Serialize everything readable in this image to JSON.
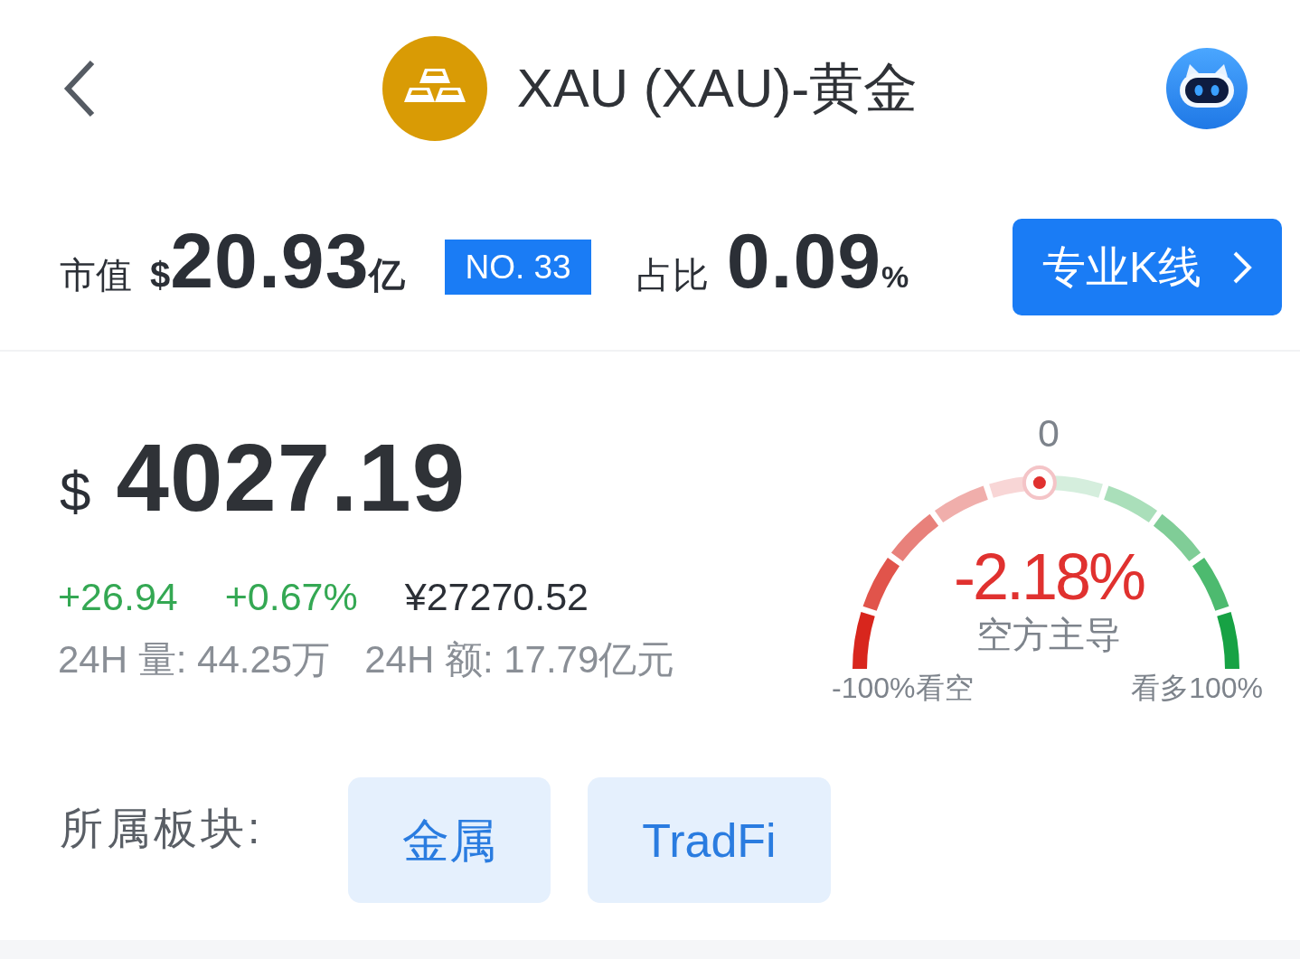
{
  "header": {
    "title": "XAU (XAU)-黄金"
  },
  "market": {
    "cap_label": "市值",
    "cap_currency": "$",
    "cap_value": "20.93",
    "cap_unit": "亿",
    "rank": "NO. 33",
    "share_label": "占比",
    "share_value": "0.09",
    "share_unit": "%",
    "kline_button": "专业K线"
  },
  "price": {
    "currency": "$",
    "value": "4027.19",
    "rising": true,
    "change": "+26.94",
    "change_percent": "+0.67%",
    "cny_price": "¥27270.52",
    "volume_24h": "24H 量: 44.25万",
    "turnover_24h": "24H 额: 17.79亿元"
  },
  "sentiment": {
    "center_tick": "0",
    "rising": false,
    "reading": "-2.18%",
    "verdict": "空方主导",
    "left_label": "-100%看空",
    "right_label": "看多100%",
    "level": 0.489
  },
  "sectors": {
    "label": "所属板块:",
    "tags": [
      "金属",
      "TradFi"
    ]
  }
}
